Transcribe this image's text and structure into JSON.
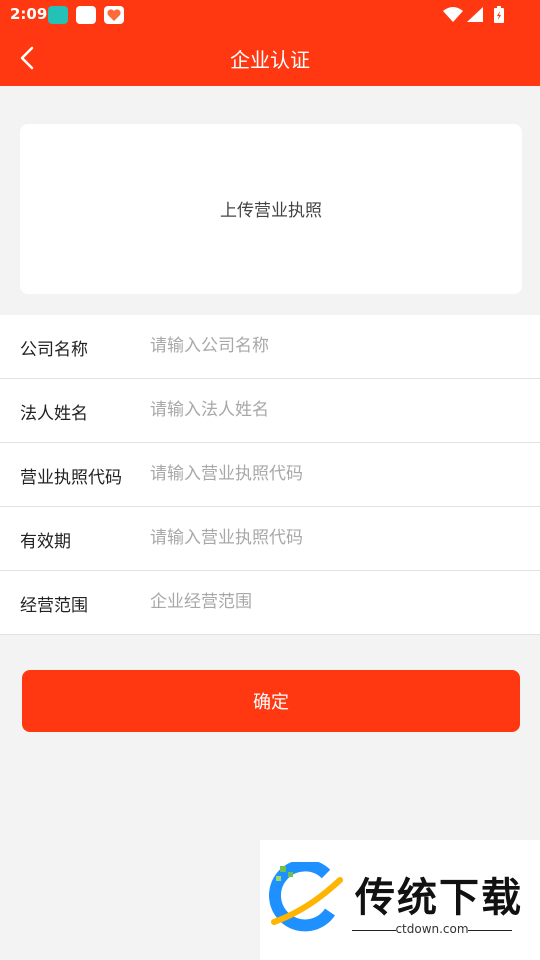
{
  "status_bar": {
    "time": "2:09",
    "icons": [
      "app-icon-green",
      "mail-icon",
      "heart-app-icon",
      "wifi-icon",
      "signal-icon",
      "battery-icon"
    ]
  },
  "header": {
    "title": "企业认证",
    "back_icon": "back-chevron-icon"
  },
  "upload": {
    "label": "上传营业执照"
  },
  "form": {
    "company_name": {
      "label": "公司名称",
      "placeholder": "请输入公司名称",
      "value": ""
    },
    "legal_person": {
      "label": "法人姓名",
      "placeholder": "请输入法人姓名",
      "value": ""
    },
    "license_code": {
      "label": "营业执照代码",
      "placeholder": "请输入营业执照代码",
      "value": ""
    },
    "validity": {
      "label": "有效期",
      "placeholder": "请输入营业执照代码",
      "value": ""
    },
    "business_scope": {
      "label": "经营范围",
      "placeholder": "企业经营范围",
      "value": ""
    }
  },
  "actions": {
    "confirm_label": "确定"
  },
  "watermark": {
    "brand": "传统下载",
    "domain": "ctdown.com"
  },
  "colors": {
    "brand": "#ff3812",
    "background": "#f3f3f3"
  }
}
